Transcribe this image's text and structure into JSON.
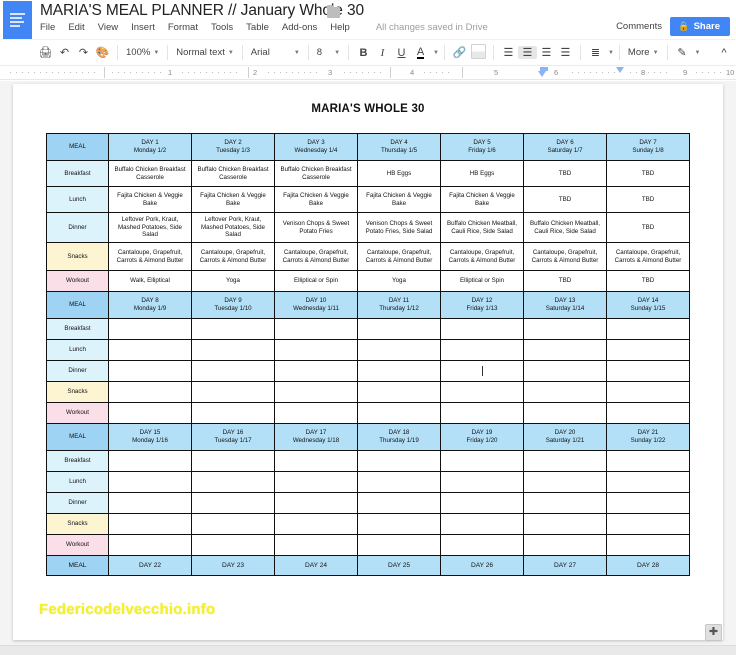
{
  "app": {
    "title": "MARIA'S MEAL PLANNER // January Whole 30",
    "save_state": "All changes saved in Drive",
    "comments_label": "Comments",
    "share_label": "Share",
    "menu": [
      "File",
      "Edit",
      "View",
      "Insert",
      "Format",
      "Tools",
      "Table",
      "Add-ons",
      "Help"
    ]
  },
  "toolbar": {
    "zoom": "100%",
    "style": "Normal text",
    "font": "Arial",
    "font_size": "8",
    "more_label": "More",
    "icons": {
      "print": "print-icon",
      "undo": "undo-icon",
      "redo": "redo-icon",
      "paint_format": "paint-format-icon",
      "bold": "B",
      "italic": "I",
      "underline": "U",
      "text_color": "A",
      "link": "link-icon",
      "image": "image-icon",
      "align_left": "align-left-icon",
      "align_center": "align-center-icon",
      "align_right": "align-right-icon",
      "align_justify": "align-justify-icon",
      "line_spacing": "line-spacing-icon",
      "pencil": "pencil-icon",
      "collapse": "collapse-toolbar-icon"
    }
  },
  "ruler": {
    "numbers": [
      "1",
      "2",
      "3",
      "4",
      "5",
      "6",
      "8",
      "9",
      "10"
    ]
  },
  "document": {
    "heading": "MARIA'S WHOLE 30",
    "watermark": "Federicodelvecchio.info",
    "meal_label": "MEAL",
    "row_labels": [
      "Breakfast",
      "Lunch",
      "Dinner",
      "Snacks",
      "Workout"
    ],
    "weeks": [
      {
        "days": [
          {
            "day": "DAY 1",
            "date": "Monday 1/2"
          },
          {
            "day": "DAY 2",
            "date": "Tuesday 1/3"
          },
          {
            "day": "DAY 3",
            "date": "Wednesday 1/4"
          },
          {
            "day": "DAY 4",
            "date": "Thursday 1/5"
          },
          {
            "day": "DAY 5",
            "date": "Friday 1/6"
          },
          {
            "day": "DAY 6",
            "date": "Saturday 1/7"
          },
          {
            "day": "DAY 7",
            "date": "Sunday 1/8"
          }
        ],
        "rows": {
          "Breakfast": [
            "Buffalo Chicken Breakfast Casserole",
            "Buffalo Chicken Breakfast Casserole",
            "Buffalo Chicken Breakfast Casserole",
            "HB Eggs",
            "HB Eggs",
            "TBD",
            "TBD"
          ],
          "Lunch": [
            "Fajita Chicken & Veggie Bake",
            "Fajita Chicken & Veggie Bake",
            "Fajita Chicken & Veggie Bake",
            "Fajita Chicken & Veggie Bake",
            "Fajita Chicken & Veggie Bake",
            "TBD",
            "TBD"
          ],
          "Dinner": [
            "Leftover Pork, Kraut, Mashed Potatoes, Side Salad",
            "Leftover Pork, Kraut, Mashed Potatoes, Side Salad",
            "Venison Chops & Sweet Potato Fries",
            "Venison Chops & Sweet Potato Fries, Side Salad",
            "Buffalo Chicken Meatball, Cauli Rice, Side Salad",
            "Buffalo Chicken Meatball, Cauli Rice, Side Salad",
            "TBD"
          ],
          "Snacks": [
            "Cantaloupe, Grapefruit, Carrots & Almond Butter",
            "Cantaloupe, Grapefruit, Carrots & Almond Butter",
            "Cantaloupe, Grapefruit, Carrots & Almond Butter",
            "Cantaloupe, Grapefruit, Carrots & Almond Butter",
            "Cantaloupe, Grapefruit, Carrots & Almond Butter",
            "Cantaloupe, Grapefruit, Carrots & Almond Butter",
            "Cantaloupe, Grapefruit, Carrots & Almond Butter"
          ],
          "Workout": [
            "Walk, Elliptical",
            "Yoga",
            "Elliptical or Spin",
            "Yoga",
            "Elliptical or Spin",
            "TBD",
            "TBD"
          ]
        }
      },
      {
        "days": [
          {
            "day": "DAY 8",
            "date": "Monday 1/9"
          },
          {
            "day": "DAY 9",
            "date": "Tuesday 1/10"
          },
          {
            "day": "DAY 10",
            "date": "Wednesday 1/11"
          },
          {
            "day": "DAY 11",
            "date": "Thursday 1/12"
          },
          {
            "day": "DAY 12",
            "date": "Friday 1/13"
          },
          {
            "day": "DAY 13",
            "date": "Saturday 1/14"
          },
          {
            "day": "DAY 14",
            "date": "Sunday 1/15"
          }
        ],
        "rows": {
          "Breakfast": [
            "",
            "",
            "",
            "",
            "",
            "",
            ""
          ],
          "Lunch": [
            "",
            "",
            "",
            "",
            "",
            "",
            ""
          ],
          "Dinner": [
            "",
            "",
            "",
            "",
            "",
            "",
            ""
          ],
          "Snacks": [
            "",
            "",
            "",
            "",
            "",
            "",
            ""
          ],
          "Workout": [
            "",
            "",
            "",
            "",
            "",
            "",
            ""
          ]
        }
      },
      {
        "days": [
          {
            "day": "DAY 15",
            "date": "Monday 1/16"
          },
          {
            "day": "DAY 16",
            "date": "Tuesday 1/17"
          },
          {
            "day": "DAY 17",
            "date": "Wednesday 1/18"
          },
          {
            "day": "DAY 18",
            "date": "Thursday 1/19"
          },
          {
            "day": "DAY 19",
            "date": "Friday 1/20"
          },
          {
            "day": "DAY 20",
            "date": "Saturday 1/21"
          },
          {
            "day": "DAY 21",
            "date": "Sunday 1/22"
          }
        ],
        "rows": {
          "Breakfast": [
            "",
            "",
            "",
            "",
            "",
            "",
            ""
          ],
          "Lunch": [
            "",
            "",
            "",
            "",
            "",
            "",
            ""
          ],
          "Dinner": [
            "",
            "",
            "",
            "",
            "",
            "",
            ""
          ],
          "Snacks": [
            "",
            "",
            "",
            "",
            "",
            "",
            ""
          ],
          "Workout": [
            "",
            "",
            "",
            "",
            "",
            "",
            ""
          ]
        }
      }
    ],
    "last_row": {
      "meal_label": "MEAL",
      "days": [
        "DAY 22",
        "DAY 23",
        "DAY 24",
        "DAY 25",
        "DAY 26",
        "DAY 27",
        "DAY 28"
      ]
    }
  },
  "colors": {
    "brand_blue": "#4285f4",
    "header_blue": "#b3e0f7",
    "meal_blue": "#9fd3f3",
    "label_blue": "#ddf3fc",
    "label_yellow": "#fdf4d2",
    "label_pink": "#fbdfe8",
    "watermark_yellow": "#f5f128"
  }
}
